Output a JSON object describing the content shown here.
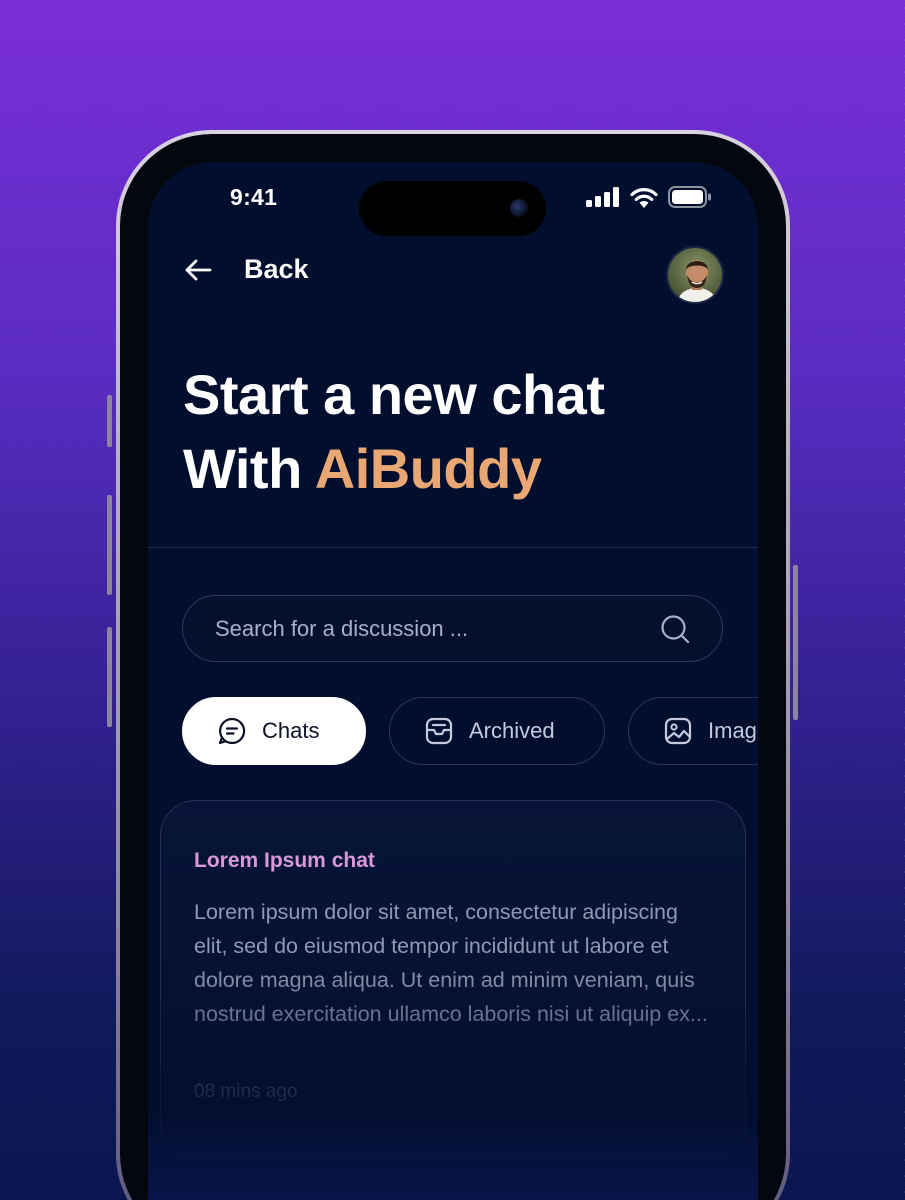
{
  "status_bar": {
    "time": "9:41"
  },
  "header": {
    "back_label": "Back"
  },
  "headline": {
    "line1": "Start a new chat",
    "line2_prefix": "With ",
    "line2_accent": "AiBuddy"
  },
  "search": {
    "placeholder": "Search for a discussion ...",
    "value": ""
  },
  "tabs": [
    {
      "label": "Chats",
      "icon": "chat-bubble-icon",
      "active": true
    },
    {
      "label": "Archived",
      "icon": "archive-box-icon",
      "active": false
    },
    {
      "label": "Images",
      "icon": "image-icon",
      "active": false
    }
  ],
  "chat_card": {
    "title": "Lorem Ipsum chat",
    "body": "Lorem ipsum dolor sit amet, consectetur adipiscing elit, sed do eiusmod tempor incididunt ut labore et dolore magna aliqua. Ut enim ad minim veniam, quis nostrud exercitation ullamco laboris nisi ut aliquip ex...",
    "time": "08 mins ago"
  },
  "colors": {
    "background_top": "#7a2ed6",
    "background_bottom": "#0a1650",
    "screen": "#020e2e",
    "accent": "#e9a873",
    "card_title": "#d998d6"
  }
}
